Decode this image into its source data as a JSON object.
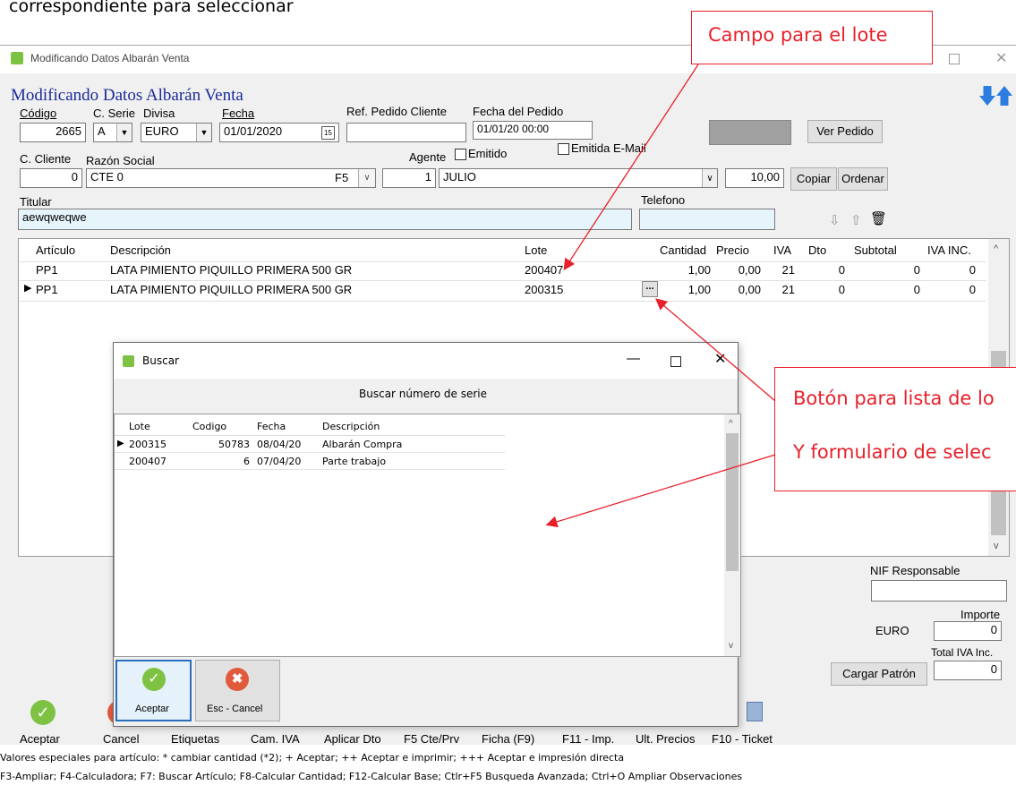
{
  "caption": "correspondiente para seleccionar",
  "window": {
    "title": "Modificando Datos Albarán Venta",
    "heading": "Modificando Datos Albarán Venta"
  },
  "form": {
    "codigo_label": "Código",
    "codigo": "2665",
    "serie_label": "C. Serie",
    "serie": "A",
    "divisa_label": "Divisa",
    "divisa": "EURO",
    "fecha_label": "Fecha",
    "fecha": "01/01/2020",
    "ref_label": "Ref. Pedido Cliente",
    "ref": "",
    "fecha_pedido_label": "Fecha del Pedido",
    "fecha_pedido": "01/01/20 00:00",
    "ver_pedido": "Ver Pedido",
    "emitido_label": "Emitido",
    "emitida_email_label": "Emitida E-Mail",
    "cliente_label": "C. Cliente",
    "cliente": "0",
    "razon_label": "Razón Social",
    "razon": "CTE 0",
    "f5": "F5",
    "agente_label": "Agente",
    "agente_code": "1",
    "agente_name": "JULIO",
    "agent_value": "10,00",
    "copiar": "Copiar",
    "ordenar": "Ordenar",
    "titular_label": "Titular",
    "titular": "aewqweqwe",
    "telefono_label": "Telefono",
    "telefono": ""
  },
  "grid": {
    "headers": [
      "Artículo",
      "Descripción",
      "Lote",
      "Cantidad",
      "Precio",
      "IVA",
      "Dto",
      "Subtotal",
      "IVA INC."
    ],
    "rows": [
      {
        "articulo": "PP1",
        "descripcion": "LATA PIMIENTO PIQUILLO PRIMERA 500 GR",
        "lote": "200407",
        "cantidad": "1,00",
        "precio": "0,00",
        "iva": "21",
        "dto": "0",
        "subtotal": "0",
        "iva_inc": "0"
      },
      {
        "articulo": "PP1",
        "descripcion": "LATA PIMIENTO PIQUILLO PRIMERA 500 GR",
        "lote": "200315",
        "cantidad": "1,00",
        "precio": "0,00",
        "iva": "21",
        "dto": "0",
        "subtotal": "0",
        "iva_inc": "0"
      }
    ],
    "ellipsis": "..."
  },
  "right_panel": {
    "nif_label": "NIF Responsable",
    "importe_label": "Importe",
    "currency": "EURO",
    "importe": "0",
    "total_label": "Total IVA Inc.",
    "total": "0",
    "cargar_patron": "Cargar Patrón"
  },
  "toolbar": {
    "items": [
      "Aceptar",
      "Cancel",
      "Etiquetas",
      "Cam. IVA",
      "Aplicar Dto",
      "F5 Cte/Prv",
      "Ficha (F9)",
      "F11 - Imp.",
      "Ult. Precios",
      "F10 - Ticket"
    ]
  },
  "status": {
    "line1": "Valores especiales para artículo: * cambiar cantidad (*2); + Aceptar; ++ Aceptar e imprimir; +++ Aceptar e impresión directa",
    "line2": "F3-Ampliar;  F4-Calculadora;  F7: Buscar Artículo; F8-Calcular Cantidad; F12-Calcular Base; Ctlr+F5 Busqueda Avanzada; Ctrl+O Ampliar Observaciones"
  },
  "dialog": {
    "title": "Buscar",
    "heading": "Buscar número de serie",
    "headers": [
      "Lote",
      "Codigo",
      "Fecha",
      "Descripción"
    ],
    "rows": [
      {
        "lote": "200315",
        "codigo": "50783",
        "fecha": "08/04/20",
        "descripcion": "Albarán Compra"
      },
      {
        "lote": "200407",
        "codigo": "6",
        "fecha": "07/04/20",
        "descripcion": "Parte trabajo"
      }
    ],
    "accept": "Aceptar",
    "cancel": "Esc - Cancel"
  },
  "annotations": {
    "lote_field": "Campo para el lote",
    "list_button_1": "Botón para lista de lo",
    "list_button_2": "Y formulario de selec"
  },
  "colors": {
    "annotation_red": "#e8202a",
    "heading_blue": "#1a2a9a",
    "input_blue_bg": "#e6f4fb",
    "accept_green": "#7dc242",
    "cancel_red": "#e25a3c"
  }
}
